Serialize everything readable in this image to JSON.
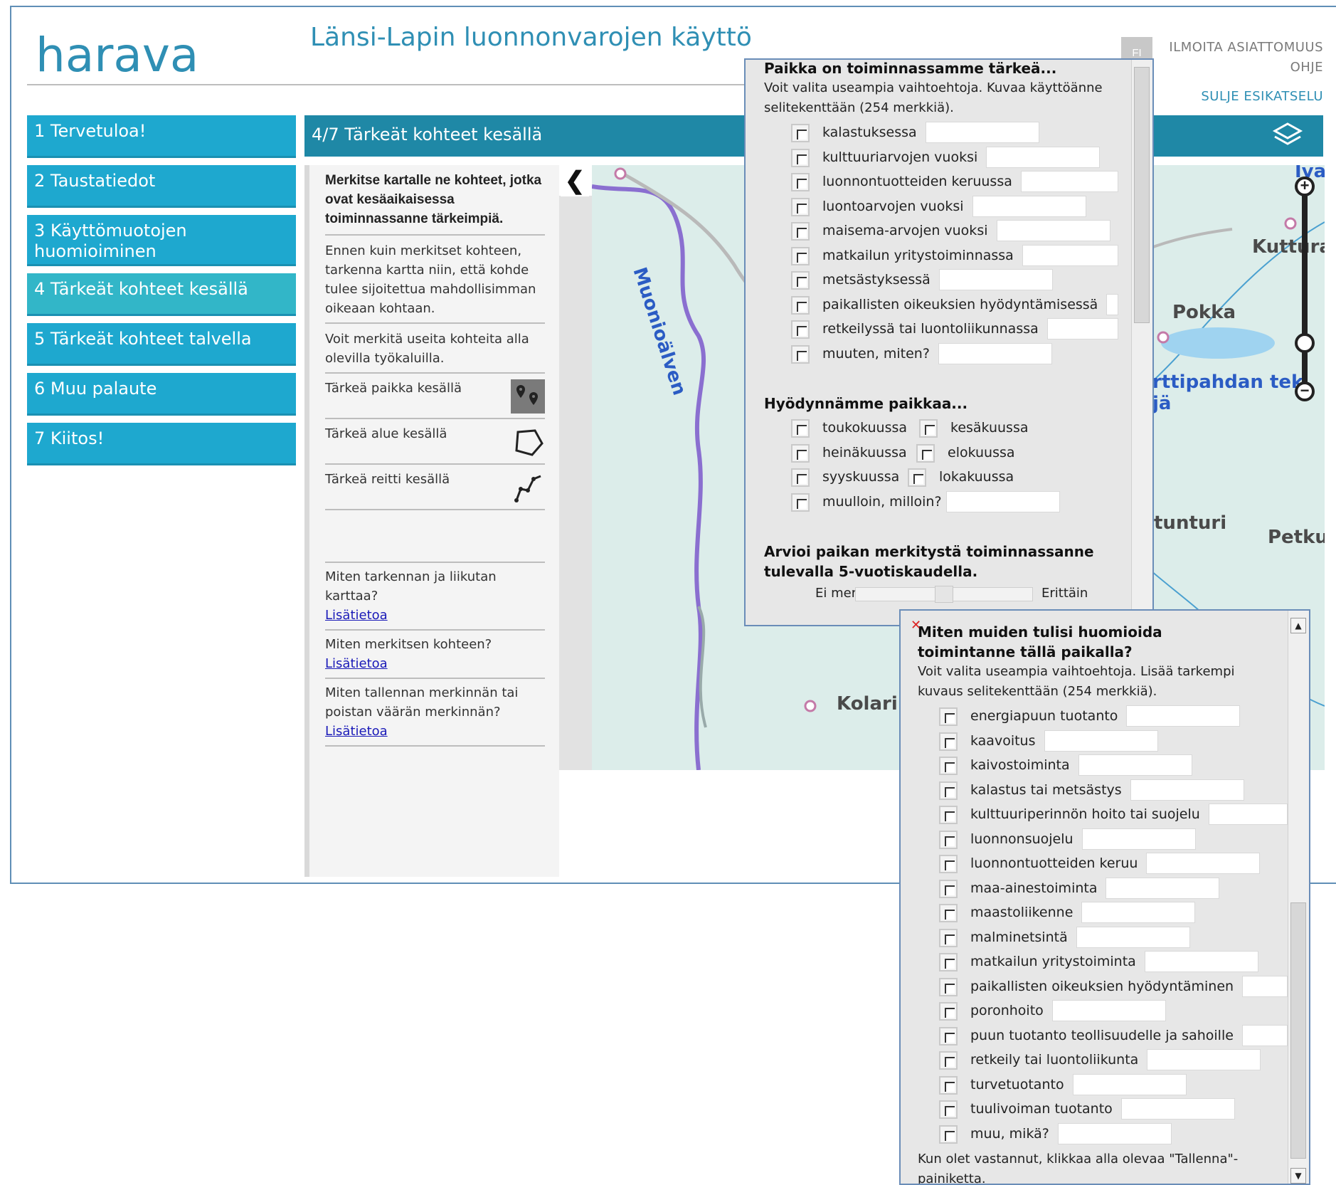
{
  "header": {
    "logo_text": "harava",
    "app_title": "Länsi-Lapin luonnonvarojen käyttö",
    "lang": "FI",
    "report_link": "ILMOITA ASIATTOMUUS",
    "help_link": "OHJE",
    "close_preview": "SULJE ESIKATSELU"
  },
  "nav": {
    "items": [
      {
        "label": "1 Tervetuloa!"
      },
      {
        "label": "2 Taustatiedot"
      },
      {
        "label": "3 Käyttömuotojen huomioiminen"
      },
      {
        "label": "4 Tärkeät kohteet kesällä"
      },
      {
        "label": "5 Tärkeät kohteet talvella"
      },
      {
        "label": "6 Muu palaute"
      },
      {
        "label": "7 Kiitos!"
      }
    ]
  },
  "step_bar": {
    "title": "4/7 Tärkeät kohteet kesällä"
  },
  "instructions": {
    "heading": "Merkitse kartalle ne kohteet, jotka ovat kesäaikaisessa toiminnassanne tärkeimpiä.",
    "p1": "Ennen kuin merkitset kohteen, tarkenna kartta niin, että kohde tulee sijoitettua mahdollisimman oikeaan kohtaan.",
    "p2": "Voit merkitä useita kohteita alla olevilla työkaluilla.",
    "tools": [
      {
        "label": "Tärkeä paikka kesällä",
        "icon": "point-marker-icon"
      },
      {
        "label": "Tärkeä alue kesällä",
        "icon": "polygon-icon"
      },
      {
        "label": "Tärkeä reitti kesällä",
        "icon": "polyline-icon"
      }
    ],
    "help": [
      {
        "q": "Miten tarkennan ja liikutan karttaa?",
        "link": "Lisätietoa"
      },
      {
        "q": "Miten merkitsen kohteen?",
        "link": "Lisätietoa"
      },
      {
        "q": "Miten tallennan merkinnän tai poistan väärän merkinnän?",
        "link": "Lisätietoa"
      }
    ]
  },
  "map": {
    "labels": [
      "Muonioälven",
      "Kuttura",
      "Pokka",
      "rttipahdan tek jä",
      "tunturi",
      "Petku",
      "Kolari",
      "Iva"
    ]
  },
  "popup1": {
    "heading": "Paikka on toiminnassamme tärkeä...",
    "hint": "Voit valita useampia vaihtoehtoja. Kuvaa käyttöänne selitekenttään (254 merkkiä).",
    "options": [
      "kalastuksessa",
      "kulttuuriarvojen vuoksi",
      "luonnontuotteiden keruussa",
      "luontoarvojen vuoksi",
      "maisema-arvojen vuoksi",
      "matkailun yritystoiminnassa",
      "metsästyksessä",
      "paikallisten oikeuksien hyödyntämisessä",
      "retkeilyssä tai luontoliikunnassa",
      "muuten, miten?"
    ],
    "months_heading": "Hyödynnämme paikkaa...",
    "months": [
      "toukokuussa",
      "kesäkuussa",
      "heinäkuussa",
      "elokuussa",
      "syyskuussa",
      "lokakuussa"
    ],
    "other_time": "muulloin, milloin?",
    "rating_heading": "Arvioi paikan merkitystä toiminnassanne tulevalla 5-vuotiskaudella.",
    "rating_min": "Ei merkittävä",
    "rating_max": "Erittäin",
    "rating_value": 0.5
  },
  "popup2": {
    "heading": "Miten muiden tulisi huomioida toimintanne tällä paikalla?",
    "hint": "Voit valita useampia vaihtoehtoja. Lisää tarkempi kuvaus selitekenttään (254 merkkiä).",
    "options": [
      "energiapuun tuotanto",
      "kaavoitus",
      "kaivostoiminta",
      "kalastus tai metsästys",
      "kulttuuriperinnön hoito tai suojelu",
      "luonnonsuojelu",
      "luonnontuotteiden keruu",
      "maa-ainestoiminta",
      "maastoliikenne",
      "malminetsintä",
      "matkailun yritystoiminta",
      "paikallisten oikeuksien hyödyntäminen",
      "poronhoito",
      "puun tuotanto teollisuudelle ja sahoille",
      "retkeily tai luontoliikunta",
      "turvetuotanto",
      "tuulivoiman tuotanto",
      "muu, mikä?"
    ],
    "footer": "Kun olet vastannut, klikkaa alla olevaa \"Tallenna\"-painiketta."
  },
  "colors": {
    "brand": "#2f8fb4",
    "nav": "#1ea8cf",
    "nav_active": "#32b6c8",
    "step_bar": "#1f88a6",
    "river": "#8a6fd0"
  }
}
